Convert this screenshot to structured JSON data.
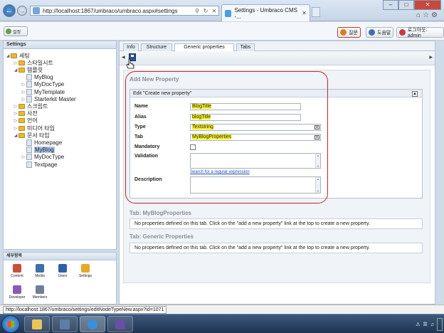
{
  "browser": {
    "url": "http://localhost:1867/umbraco/umbraco.aspx#settings",
    "tab_title": "Settings - Umbraco CMS -...",
    "status_url": "http://localhost:1867/umbraco/settings/editNodeTypeNew.aspx?id=1071"
  },
  "appbar": {
    "logo_label": "설정",
    "help_label": "질문",
    "helpdesk_label": "도움말",
    "logout_label": "로그아웃: admin"
  },
  "sidebar": {
    "title": "Settings",
    "tree": [
      {
        "label": "세팅",
        "type": "folder",
        "level": 0,
        "arrow": "open"
      },
      {
        "label": "스타일시트",
        "type": "folder",
        "level": 1,
        "arrow": "closed"
      },
      {
        "label": "템플릿",
        "type": "folder",
        "level": 1,
        "arrow": "open"
      },
      {
        "label": "MyBlog",
        "type": "doc",
        "level": 2,
        "arrow": ""
      },
      {
        "label": "MyDocType",
        "type": "doc",
        "level": 2,
        "arrow": "closed"
      },
      {
        "label": "MyTemplate",
        "type": "doc",
        "level": 2,
        "arrow": "closed"
      },
      {
        "label": "Starterkit Master",
        "type": "doc",
        "level": 2,
        "arrow": "closed"
      },
      {
        "label": "스크립트",
        "type": "folder",
        "level": 1,
        "arrow": "closed"
      },
      {
        "label": "사전",
        "type": "folder",
        "level": 1,
        "arrow": "closed"
      },
      {
        "label": "언어",
        "type": "folder",
        "level": 1,
        "arrow": "closed"
      },
      {
        "label": "미디어 타입",
        "type": "folder",
        "level": 1,
        "arrow": "closed"
      },
      {
        "label": "문서 타입",
        "type": "folder",
        "level": 1,
        "arrow": "open"
      },
      {
        "label": "Homepage",
        "type": "doc",
        "level": 2,
        "arrow": ""
      },
      {
        "label": "MyBlog",
        "type": "doc",
        "level": 2,
        "arrow": "",
        "selected": true
      },
      {
        "label": "MyDocType",
        "type": "doc",
        "level": 2,
        "arrow": "closed"
      },
      {
        "label": "Textpage",
        "type": "doc",
        "level": 2,
        "arrow": ""
      }
    ]
  },
  "sections": {
    "title": "세부항목",
    "items": [
      {
        "label": "Content",
        "icon": "content-icon",
        "color": "#c8513a"
      },
      {
        "label": "Media",
        "icon": "media-icon",
        "color": "#3d6fa8"
      },
      {
        "label": "Users",
        "icon": "users-icon",
        "color": "#2f5fa6"
      },
      {
        "label": "Settings",
        "icon": "settings-icon",
        "color": "#e4a92a"
      },
      {
        "label": "Developer",
        "icon": "developer-icon",
        "color": "#8a5bb8"
      },
      {
        "label": "Members",
        "icon": "members-icon",
        "color": "#6f7f95"
      }
    ]
  },
  "main": {
    "tabs": [
      "Info",
      "Structure",
      "Generic properties",
      "Tabs"
    ],
    "active_tab": "Generic properties",
    "add_new_property": "Add New Property",
    "edit_title": "Edit \"Create new property\"",
    "fields": {
      "name_label": "Name",
      "name_value": "BlogTitle",
      "alias_label": "Alias",
      "alias_value": "blogTitle",
      "type_label": "Type",
      "type_value": "Textstring",
      "tab_label": "Tab",
      "tab_value": "MyBlogProperties",
      "mandatory_label": "Mandatory",
      "validation_label": "Validation",
      "regex_link": "Search for a regular expression",
      "description_label": "Description"
    },
    "tab_sections": [
      {
        "title": "Tab: MyBlogProperties",
        "message": "No properties defined on this tab. Click on the \"add a new property\" link at the top to create a new property."
      },
      {
        "title": "Tab: Generic Properties",
        "message": "No properties defined on this tab. Click on the \"add a new property\" link at the top to create a new property."
      }
    ]
  },
  "colors": {
    "highlight": "#f7f31d",
    "annotation_ring": "#c7232a",
    "link": "#1d4fb0"
  }
}
